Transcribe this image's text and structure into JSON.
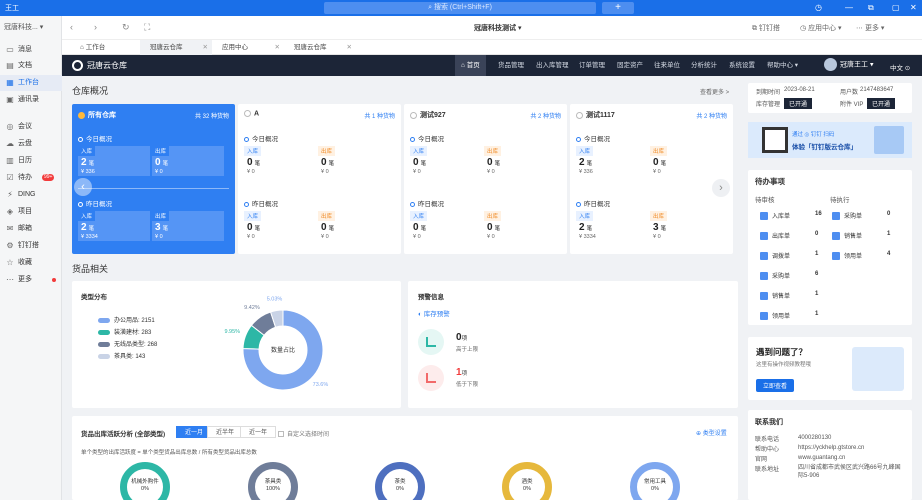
{
  "os": {
    "title": "王工",
    "search_placeholder": "搜索 (Ctrl+Shift+F)",
    "plus": "+"
  },
  "sidebar": {
    "org": "冠唐科技...",
    "items": [
      {
        "label": "消息"
      },
      {
        "label": "文档"
      },
      {
        "label": "工作台"
      },
      {
        "label": "通讯录"
      },
      {
        "label": "会议"
      },
      {
        "label": "云盘"
      },
      {
        "label": "日历"
      },
      {
        "label": "待办",
        "badge": "99+"
      },
      {
        "label": "DING"
      },
      {
        "label": "项目"
      },
      {
        "label": "邮箱"
      },
      {
        "label": "钉钉搭"
      },
      {
        "label": "收藏"
      },
      {
        "label": "更多"
      }
    ]
  },
  "toolbar": {
    "workspace": "冠唐科技测试",
    "dingpan": "钉钉搭",
    "appcenter": "应用中心",
    "more": "更多"
  },
  "tabs": [
    {
      "label": "工作台"
    },
    {
      "label": "冠唐云仓库"
    },
    {
      "label": "应用中心"
    },
    {
      "label": "冠唐云仓库"
    }
  ],
  "app": {
    "logo": "冠唐云仓库",
    "menu": [
      "首页",
      "货品管理",
      "出入库管理",
      "订单管理",
      "固定资产",
      "往来单位",
      "分析统计",
      "系统设置",
      "帮助中心"
    ],
    "user": "冠唐王工",
    "lang": "中文"
  },
  "overview": {
    "title": "仓库概况",
    "more": "查看更多 >",
    "cards": [
      {
        "name": "所有仓库",
        "count": "共 32 种货物",
        "today": "今日概况",
        "yesterday": "昨日概况",
        "t_in": "2",
        "t_in_amt": "¥ 336",
        "t_out": "0",
        "t_out_amt": "¥ 0",
        "y_in": "2",
        "y_in_amt": "¥ 3334",
        "y_out": "3",
        "y_out_amt": "¥ 0"
      },
      {
        "name": "A",
        "count": "共 1 种货物",
        "today": "今日概况",
        "yesterday": "昨日概况",
        "t_in": "0",
        "t_in_amt": "¥ 0",
        "t_out": "0",
        "t_out_amt": "¥ 0",
        "y_in": "0",
        "y_in_amt": "¥ 0",
        "y_out": "0",
        "y_out_amt": "¥ 0"
      },
      {
        "name": "测试927",
        "count": "共 2 种货物",
        "today": "今日概况",
        "yesterday": "昨日概况",
        "t_in": "0",
        "t_in_amt": "¥ 0",
        "t_out": "0",
        "t_out_amt": "¥ 0",
        "y_in": "0",
        "y_in_amt": "¥ 0",
        "y_out": "0",
        "y_out_amt": "¥ 0"
      },
      {
        "name": "测试1117",
        "count": "共 2 种货物",
        "today": "今日概况",
        "yesterday": "昨日概况",
        "t_in": "2",
        "t_in_amt": "¥ 336",
        "t_out": "0",
        "t_out_amt": "¥ 0",
        "y_in": "2",
        "y_in_amt": "¥ 3334",
        "y_out": "3",
        "y_out_amt": "¥ 0"
      }
    ],
    "in_label": "入库",
    "out_label": "出库",
    "unit": "笔"
  },
  "right": {
    "expire_label": "到期时间",
    "expire": "2023-08-21",
    "uid_label": "用户数",
    "uid": "2147483647",
    "stock_label": "库存管理",
    "stock_btn": "已开通",
    "vip_label": "附件 VIP",
    "vip_btn": "已开通",
    "ad1_line1": "通过 ◎ 钉钉 扫码",
    "ad1_line2": "体验「钉钉版云仓库」",
    "todo_title": "待办事项",
    "todo_col1": "待审核",
    "todo_col2": "待执行",
    "todo_left": [
      {
        "label": "入库单",
        "v": "16"
      },
      {
        "label": "出库单",
        "v": "0"
      },
      {
        "label": "调拨单",
        "v": "1"
      },
      {
        "label": "采购单",
        "v": "6"
      },
      {
        "label": "销售单",
        "v": "1"
      },
      {
        "label": "领用单",
        "v": "1"
      }
    ],
    "todo_right": [
      {
        "label": "采购单",
        "v": "0"
      },
      {
        "label": "销售单",
        "v": "1"
      },
      {
        "label": "领用单",
        "v": "4"
      }
    ],
    "ad2_title": "遇到问题了？",
    "ad2_sub": "这里有操作视频教程哦",
    "ad2_btn": "立即查看",
    "contact_title": "联系我们",
    "contact": [
      {
        "k": "联系电话",
        "v": "4000280130"
      },
      {
        "k": "帮助中心",
        "v": "https://yckhelp.gtstore.cn"
      },
      {
        "k": "官网",
        "v": "www.guantang.cn"
      },
      {
        "k": "联系地址",
        "v": "四川省成都市武侯区武兴路66号九峰国际5-906"
      }
    ]
  },
  "goods": {
    "title": "货品相关",
    "type_title": "类型分布",
    "legend": [
      {
        "label": "办公用品: 2151",
        "color": "#7ea7ef"
      },
      {
        "label": "装潢建材: 283",
        "color": "#2db7a6"
      },
      {
        "label": "无线品类型: 268",
        "color": "#6f7d99"
      },
      {
        "label": "茶具类: 143",
        "color": "#c9d3e6"
      }
    ],
    "donut_center": "数量占比",
    "pct": [
      "73.6%",
      "9.95%",
      "9.42%",
      "5.03%"
    ],
    "warn_title": "预警信息",
    "warn_sub": "库存预警",
    "warn_items": [
      {
        "n": "0",
        "unit": "项",
        "label": "高于上限"
      },
      {
        "n": "1",
        "unit": "项",
        "label": "低于下限"
      }
    ]
  },
  "chart_data": {
    "type": "pie",
    "title": "类型分布",
    "categories": [
      "办公用品",
      "装潢建材",
      "无线品类型",
      "茶具类"
    ],
    "values": [
      2151,
      283,
      268,
      143
    ],
    "percent_labels": [
      "73.6%",
      "9.95%",
      "9.42%",
      "5.03%"
    ]
  },
  "activity": {
    "title": "货品出库活跃分析 (全部类型)",
    "seg": [
      "近一月",
      "近半年",
      "近一年"
    ],
    "custom": "自定义选择时间",
    "type_setting": "类型设置",
    "formula": "单个类型的出库活跃度 = 单个类型货品出库总数 / 所有类型货品出库总数",
    "rings": [
      {
        "name": "机械外购件",
        "pct": "0%",
        "color": "#2db7a6"
      },
      {
        "name": "茶具类",
        "pct": "100%",
        "color": "#6f7d99"
      },
      {
        "name": "茶类",
        "pct": "0%",
        "color": "#4e6fbf"
      },
      {
        "name": "酒类",
        "pct": "0%",
        "color": "#e6b83c"
      },
      {
        "name": "常用工具",
        "pct": "0%",
        "color": "#7ea7ef"
      }
    ]
  }
}
